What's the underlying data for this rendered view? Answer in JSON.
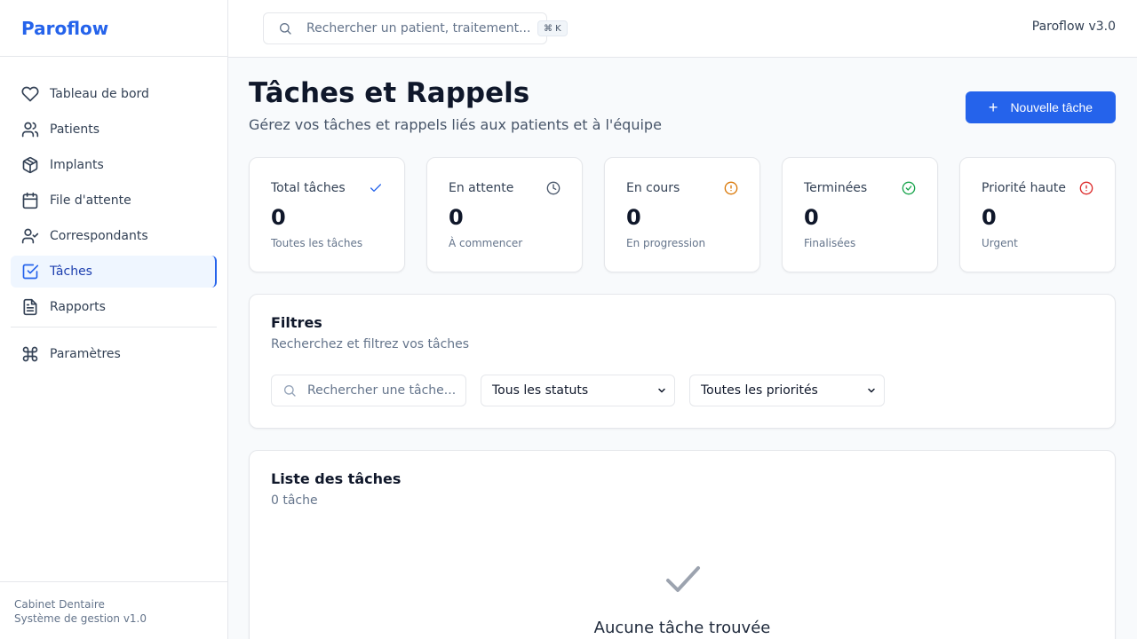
{
  "brand": "Paroflow",
  "nav": [
    {
      "label": "Tableau de bord",
      "icon": "heart-icon"
    },
    {
      "label": "Patients",
      "icon": "users-icon"
    },
    {
      "label": "Implants",
      "icon": "package-icon"
    },
    {
      "label": "File d'attente",
      "icon": "calendar-icon"
    },
    {
      "label": "Correspondants",
      "icon": "user-check-icon"
    },
    {
      "label": "Tâches",
      "icon": "check-square-icon",
      "active": true
    },
    {
      "label": "Rapports",
      "icon": "file-text-icon"
    }
  ],
  "settings": {
    "label": "Paramètres",
    "icon": "command-icon"
  },
  "footer": {
    "line1": "Cabinet Dentaire",
    "line2": "Système de gestion v1.0"
  },
  "topbar": {
    "search_placeholder": "Rechercher un patient, traitement...",
    "shortcut": "⌘ K",
    "version": "Paroflow v3.0"
  },
  "page": {
    "title": "Tâches et Rappels",
    "subtitle": "Gérez vos tâches et rappels liés aux patients et à l'équipe",
    "new_button": "Nouvelle tâche"
  },
  "stats": [
    {
      "label": "Total tâches",
      "value": "0",
      "desc": "Toutes les tâches",
      "icon": "check-icon",
      "color": "#2563eb"
    },
    {
      "label": "En attente",
      "value": "0",
      "desc": "À commencer",
      "icon": "clock-icon",
      "color": "#475569"
    },
    {
      "label": "En cours",
      "value": "0",
      "desc": "En progression",
      "icon": "alert-circle-icon",
      "color": "#d97706"
    },
    {
      "label": "Terminées",
      "value": "0",
      "desc": "Finalisées",
      "icon": "check-circle-icon",
      "color": "#16a34a"
    },
    {
      "label": "Priorité haute",
      "value": "0",
      "desc": "Urgent",
      "icon": "alert-circle-icon",
      "color": "#dc2626"
    }
  ],
  "filters": {
    "title": "Filtres",
    "subtitle": "Recherchez et filtrez vos tâches",
    "search_placeholder": "Rechercher une tâche...",
    "status_value": "Tous les statuts",
    "priority_value": "Toutes les priorités"
  },
  "list": {
    "title": "Liste des tâches",
    "count": "0 tâche",
    "empty": "Aucune tâche trouvée"
  },
  "colors": {
    "accent": "#2563eb"
  }
}
